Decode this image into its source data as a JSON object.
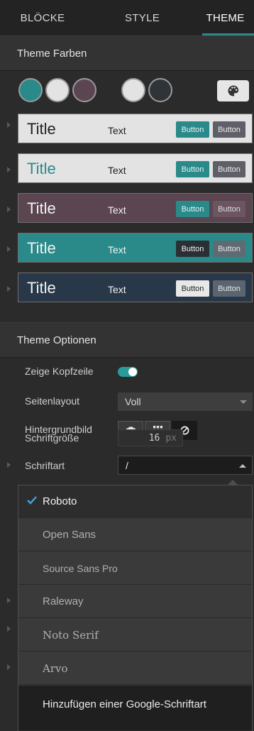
{
  "tabs": [
    {
      "label": "BLÖCKE"
    },
    {
      "label": "STYLE"
    },
    {
      "label": "THEME",
      "active": true
    }
  ],
  "theme_colors": {
    "heading": "Theme Farben",
    "swatches": [
      "#2a8a8a",
      "#e3e3e3",
      "#5a4550",
      "#e3e3e3",
      "#2e3437"
    ],
    "palette_icon": "palette-icon"
  },
  "themes": [
    {
      "title": "Title",
      "text": "Text",
      "button1": "Button",
      "button2": "Button",
      "bg": "#e3e3e3",
      "title_color": "#222222",
      "text_color": "#222222",
      "b1_bg": "#2a8a8a",
      "b1_fg": "#e8f4f4",
      "b2_bg": "#5f5f68",
      "b2_fg": "#eeeeee"
    },
    {
      "title": "Title",
      "text": "Text",
      "button1": "Button",
      "button2": "Button",
      "bg": "#e3e3e3",
      "title_color": "#2a8a8a",
      "text_color": "#222222",
      "b1_bg": "#2a8a8a",
      "b1_fg": "#e8f4f4",
      "b2_bg": "#5f5f68",
      "b2_fg": "#eeeeee"
    },
    {
      "title": "Title",
      "text": "Text",
      "button1": "Button",
      "button2": "Button",
      "bg": "#5a4550",
      "title_color": "#f2f2f2",
      "text_color": "#f2f2f2",
      "b1_bg": "#2a8a8a",
      "b1_fg": "#e8f4f4",
      "b2_bg": "#6a5560",
      "b2_fg": "#dddddd"
    },
    {
      "title": "Title",
      "text": "Text",
      "button1": "Button",
      "button2": "Button",
      "bg": "#2a8a8a",
      "title_color": "#f2f2f2",
      "text_color": "#f2f2f2",
      "b1_bg": "#2a2f33",
      "b1_fg": "#f2f2f2",
      "b2_bg": "#5f6b72",
      "b2_fg": "#e8e8e8"
    },
    {
      "title": "Title",
      "text": "Text",
      "button1": "Button",
      "button2": "Button",
      "bg": "#283848",
      "title_color": "#f2f2f2",
      "text_color": "#f2f2f2",
      "b1_bg": "#e8e8e8",
      "b1_fg": "#222222",
      "b2_bg": "#5a6570",
      "b2_fg": "#e8e8e8"
    }
  ],
  "theme_options": {
    "heading": "Theme Optionen",
    "show_header_label": "Zeige Kopfzeile",
    "show_header_on": true,
    "page_layout_label": "Seitenlayout",
    "page_layout_value": "Voll",
    "background_image_label": "Hintergrundbild",
    "background_icons": [
      "camera-icon",
      "grid-icon",
      "no-image-icon"
    ],
    "font_size_label": "Schriftgröße",
    "font_size_value": "16",
    "font_size_unit": "px",
    "font_label": "Schriftart",
    "font_value": "/"
  },
  "font_dropdown": {
    "items": [
      {
        "label": "Roboto",
        "selected": true
      },
      {
        "label": "Open Sans"
      },
      {
        "label": "Source Sans Pro"
      },
      {
        "label": "Raleway"
      },
      {
        "label": "Noto Serif"
      },
      {
        "label": "Arvo"
      }
    ],
    "add_label": "Hinzufügen einer Google-Schriftart"
  }
}
